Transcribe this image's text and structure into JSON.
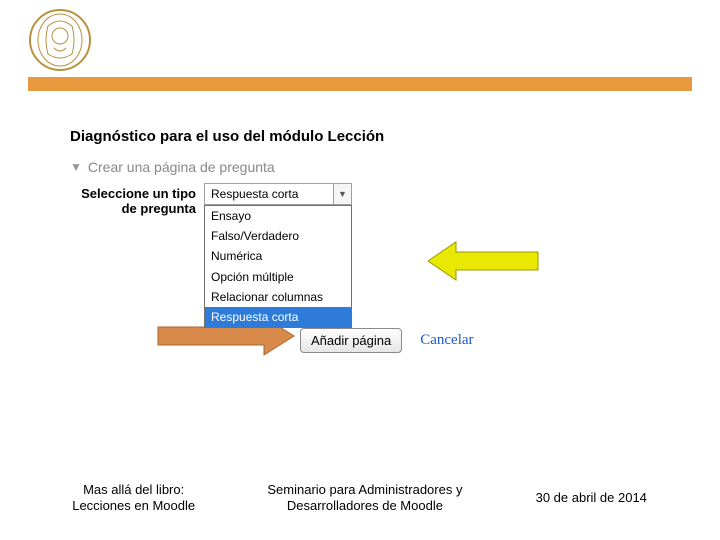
{
  "header": {
    "page_title": "Diagnóstico para el uso del módulo Lección",
    "section_label": "Crear una página de pregunta",
    "field_label": "Seleccione un tipo de pregunta"
  },
  "question_type": {
    "selected": "Respuesta corta",
    "options": [
      "Ensayo",
      "Falso/Verdadero",
      "Numérica",
      "Opción múltiple",
      "Relacionar columnas",
      "Respuesta corta"
    ],
    "highlighted": "Respuesta corta"
  },
  "actions": {
    "add_page": "Añadir página",
    "cancel": "Cancelar"
  },
  "footer": {
    "left_line1": "Mas allá del libro:",
    "left_line2": "Lecciones en Moodle",
    "mid_line1": "Seminario para Administradores y",
    "mid_line2": "Desarrolladores de Moodle",
    "right": "30 de abril de 2014"
  }
}
